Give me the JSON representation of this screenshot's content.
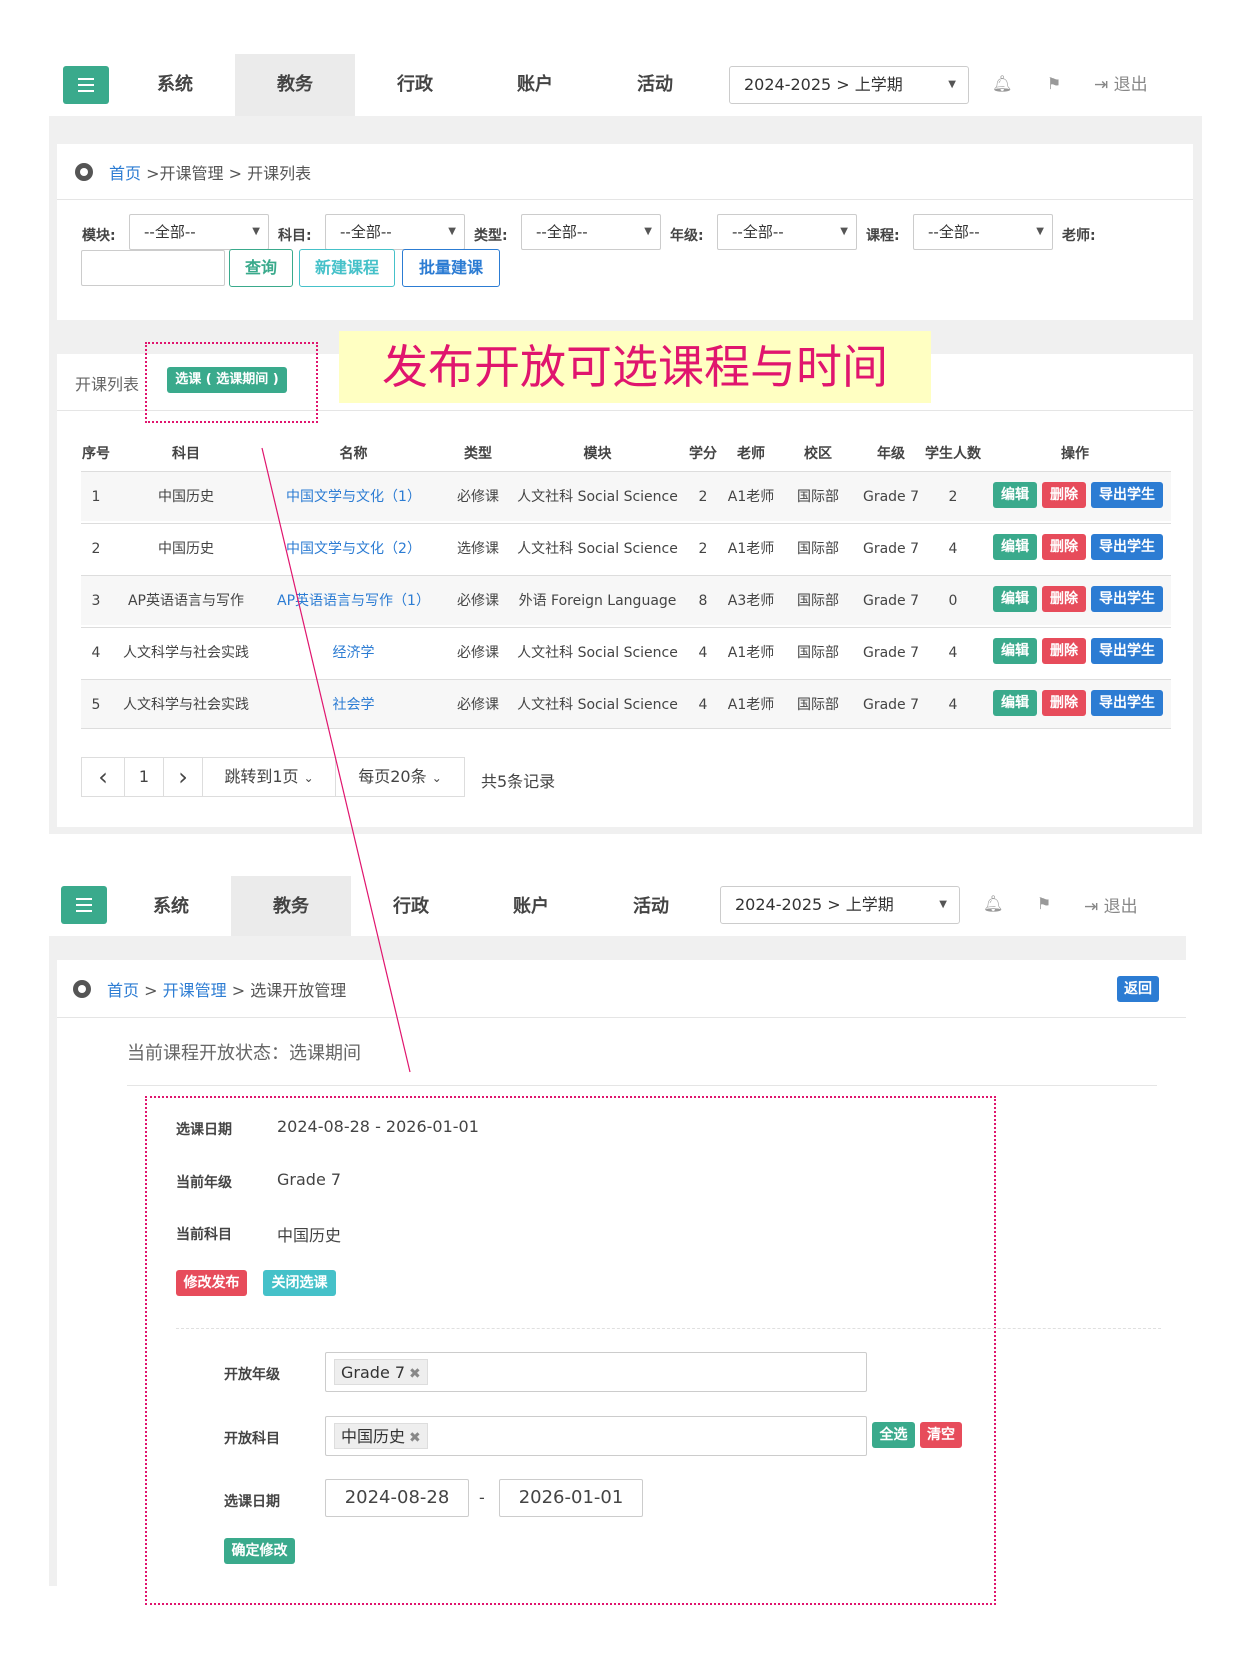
{
  "nav": {
    "items": [
      "系统",
      "教务",
      "行政",
      "账户",
      "活动"
    ],
    "term": "2024-2025 > 上学期",
    "logout": "退出"
  },
  "list_page": {
    "breadcrumb": {
      "home": "首页",
      "path": " >开课管理 > 开课列表"
    },
    "filters": {
      "module_label": "模块:",
      "subject_label": "科目:",
      "type_label": "类型:",
      "grade_label": "年级:",
      "course_label": "课程:",
      "teacher_label": "老师:",
      "all_option": "--全部--"
    },
    "buttons": {
      "query": "查询",
      "new_course": "新建课程",
      "batch_create": "批量建课"
    },
    "tabs": {
      "course_list": "开课列表",
      "selection_badge": "选课 ( 选课期间 )"
    },
    "columns": [
      "序号",
      "科目",
      "名称",
      "类型",
      "模块",
      "学分",
      "老师",
      "校区",
      "年级",
      "学生人数",
      "操作"
    ],
    "rows": [
      {
        "no": "1",
        "subject": "中国历史",
        "name": "中国文学与文化（1）",
        "type": "必修课",
        "module": "人文社科 Social Science",
        "credit": "2",
        "teacher": "A1老师",
        "campus": "国际部",
        "grade": "Grade 7",
        "students": "2"
      },
      {
        "no": "2",
        "subject": "中国历史",
        "name": "中国文学与文化（2）",
        "type": "选修课",
        "module": "人文社科 Social Science",
        "credit": "2",
        "teacher": "A1老师",
        "campus": "国际部",
        "grade": "Grade 7",
        "students": "4"
      },
      {
        "no": "3",
        "subject": "AP英语语言与写作",
        "name": "AP英语语言与写作（1）",
        "type": "必修课",
        "module": "外语 Foreign Language",
        "credit": "8",
        "teacher": "A3老师",
        "campus": "国际部",
        "grade": "Grade 7",
        "students": "0"
      },
      {
        "no": "4",
        "subject": "人文科学与社会实践",
        "name": "经济学",
        "type": "必修课",
        "module": "人文社科 Social Science",
        "credit": "4",
        "teacher": "A1老师",
        "campus": "国际部",
        "grade": "Grade 7",
        "students": "4"
      },
      {
        "no": "5",
        "subject": "人文科学与社会实践",
        "name": "社会学",
        "type": "必修课",
        "module": "人文社科 Social Science",
        "credit": "4",
        "teacher": "A1老师",
        "campus": "国际部",
        "grade": "Grade 7",
        "students": "4"
      }
    ],
    "row_actions": {
      "edit": "编辑",
      "delete": "删除",
      "export": "导出学生"
    },
    "pager": {
      "prev": "‹",
      "page": "1",
      "next": "›",
      "jump": "跳转到1页",
      "per_page": "每页20条",
      "total": "共5条记录"
    }
  },
  "annotation": "发布开放可选课程与时间",
  "detail_page": {
    "breadcrumb": {
      "home": "首页",
      "sep1": " > ",
      "mid": "开课管理",
      "rest": " > 选课开放管理"
    },
    "back": "返回",
    "status": "当前课程开放状态：选课期间",
    "info": {
      "date_label": "选课日期",
      "date_value": "2024-08-28 -  2026-01-01",
      "grade_label": "当前年级",
      "grade_value": "Grade 7",
      "subject_label": "当前科目",
      "subject_value": "中国历史"
    },
    "buttons": {
      "modify_publish": "修改发布",
      "close_selection": "关闭选课"
    },
    "form": {
      "open_grade_label": "开放年级",
      "open_grade_tag": "Grade 7",
      "open_subject_label": "开放科目",
      "open_subject_tag": "中国历史",
      "select_all": "全选",
      "clear": "清空",
      "date_label": "选课日期",
      "start_date": "2024-08-28",
      "date_sep": "-",
      "end_date": "2026-01-01",
      "confirm": "确定修改"
    }
  }
}
